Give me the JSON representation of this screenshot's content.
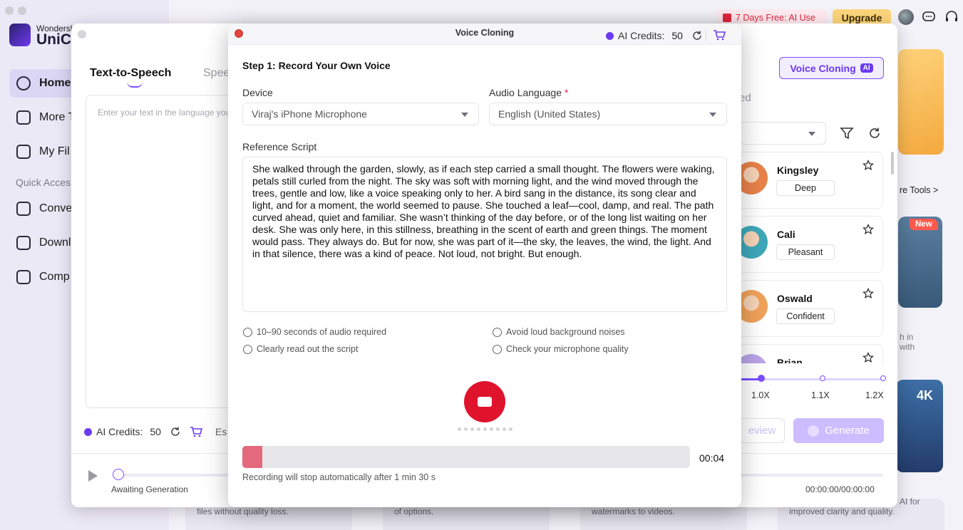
{
  "bg_app": {
    "brand_small": "Wondersh",
    "brand_big": "UniCo",
    "nav": [
      {
        "label": "Home",
        "active": true
      },
      {
        "label": "More T",
        "active": false
      },
      {
        "label": "My Fil",
        "active": false
      }
    ],
    "quick_access_label": "Quick Acces",
    "quick_items": [
      "Conve",
      "Downl",
      "Comp"
    ],
    "promo": "7 Days Free: AI Use",
    "upgrade": "Upgrade",
    "more_tools": "re Tools >",
    "new_badge": "New",
    "badge_4k": "4K",
    "card_texts": [
      "files without quality loss.",
      "of options.",
      "watermarks to videos.",
      "improved clarity and quality."
    ],
    "side_snippets": [
      "h in",
      "with",
      "AI for"
    ]
  },
  "tts": {
    "tab_active": "Text-to-Speech",
    "tab_other": "Spee",
    "placeholder": "Enter your text in the language you",
    "credits_label": "AI Credits:",
    "credits_value": "50",
    "credits_extra": "Es",
    "awaiting": "Awaiting Generation",
    "timecode": "00:00:00/00:00:00",
    "voice_cloning_label": "Voice Cloning",
    "ai_badge": "AI",
    "partial_header": "ed",
    "voices": [
      {
        "name": "Kingsley",
        "tag": "Deep",
        "color": "#e8824a"
      },
      {
        "name": "Cali",
        "tag": "Pleasant",
        "color": "#3ea8b9"
      },
      {
        "name": "Oswald",
        "tag": "Confident",
        "color": "#f0a25a"
      },
      {
        "name": "Brian",
        "tag": "",
        "color": "#b9a4e8"
      }
    ],
    "speeds": [
      "1.0X",
      "1.1X",
      "1.2X"
    ],
    "speed_selected": "1.0X",
    "preview": "eview",
    "generate": "Generate"
  },
  "vc": {
    "title": "Voice Cloning",
    "credits_label": "AI Credits:",
    "credits_value": "50",
    "step": "Step 1: Record Your Own Voice",
    "device_label": "Device",
    "device_value": "Viraj's iPhone Microphone",
    "language_label": "Audio Language",
    "language_value": "English (United States)",
    "ref_label": "Reference Script",
    "script": "She walked through the garden, slowly, as if each step carried a small thought. The flowers were waking, petals still curled from the night. The sky was soft with morning light, and the wind moved through the trees, gentle and low, like a voice speaking only to her. A bird sang in the distance, its song clear and light, and for a moment, the world seemed to pause. She touched a leaf—cool, damp, and real. The path curved ahead, quiet and familiar. She wasn’t thinking of the day before, or of the long list waiting on her desk. She was only here, in this stillness, breathing in the scent of earth and green things. The moment would pass. They always do. But for now, she was part of it—the sky, the leaves, the wind, the light. And in that silence, there was a kind of peace. Not loud, not bright. But enough.",
    "tips": [
      "10–90 seconds of audio required",
      "Avoid loud background noises",
      "Clearly read out the script",
      "Check your microphone quality"
    ],
    "elapsed": "00:04",
    "progress_fraction": 0.044,
    "note": "Recording will stop automatically after 1 min 30 s"
  }
}
